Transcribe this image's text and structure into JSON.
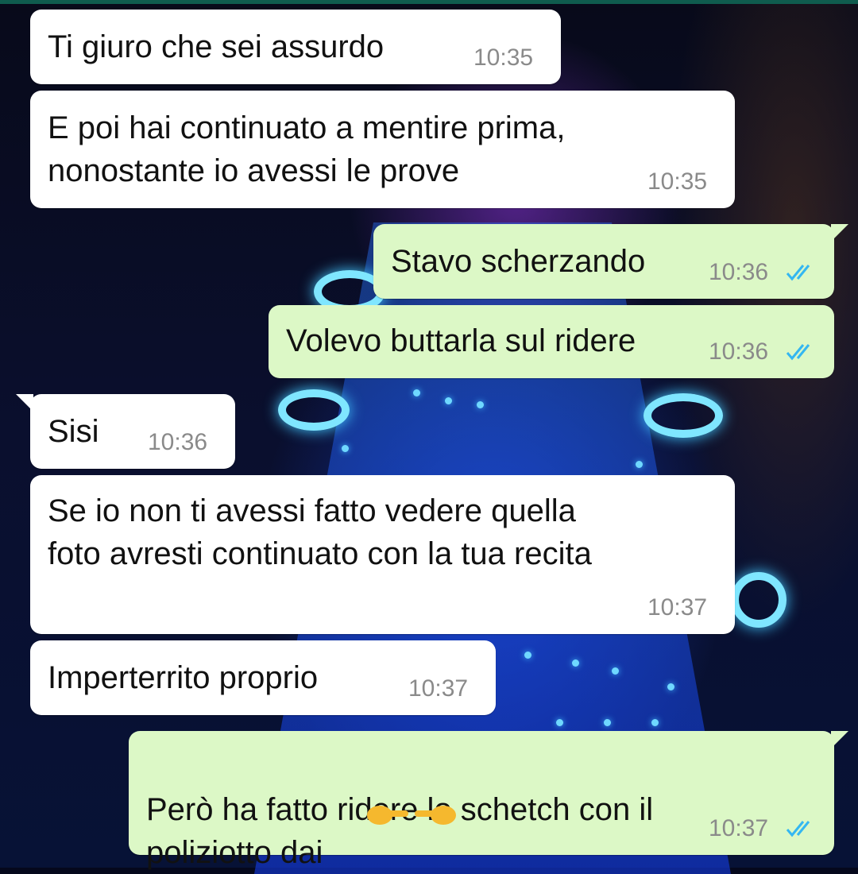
{
  "chat": {
    "messages": [
      {
        "direction": "in",
        "text": "Ti giuro che sei assurdo",
        "time": "10:35"
      },
      {
        "direction": "in",
        "text": "E poi hai continuato a mentire prima,\nnonostante io avessi le prove",
        "time": "10:35"
      },
      {
        "direction": "out",
        "text": "Stavo scherzando",
        "time": "10:36",
        "status": "read"
      },
      {
        "direction": "out",
        "text": "Volevo buttarla sul ridere",
        "time": "10:36",
        "status": "read"
      },
      {
        "direction": "in",
        "text": "Sisi",
        "time": "10:36"
      },
      {
        "direction": "in",
        "text": "Se io non ti avessi fatto vedere quella\nfoto avresti continuato con la tua recita",
        "time": "10:37"
      },
      {
        "direction": "in",
        "text": "Imperterrito proprio",
        "time": "10:37"
      },
      {
        "direction": "out",
        "text": "Però ha fatto ridere lo schetch con il\npoliziotto dai",
        "time": "10:37",
        "status": "read",
        "emoji": "pointing-hands-emoji"
      }
    ]
  },
  "colors": {
    "incoming_bubble": "#ffffff",
    "outgoing_bubble": "#dcf8c6",
    "timestamp": "#8a8a8a",
    "read_ticks": "#34b7f1",
    "top_strip": "#0f5c4e"
  },
  "icons": {
    "read_receipt": "double-check-icon"
  }
}
